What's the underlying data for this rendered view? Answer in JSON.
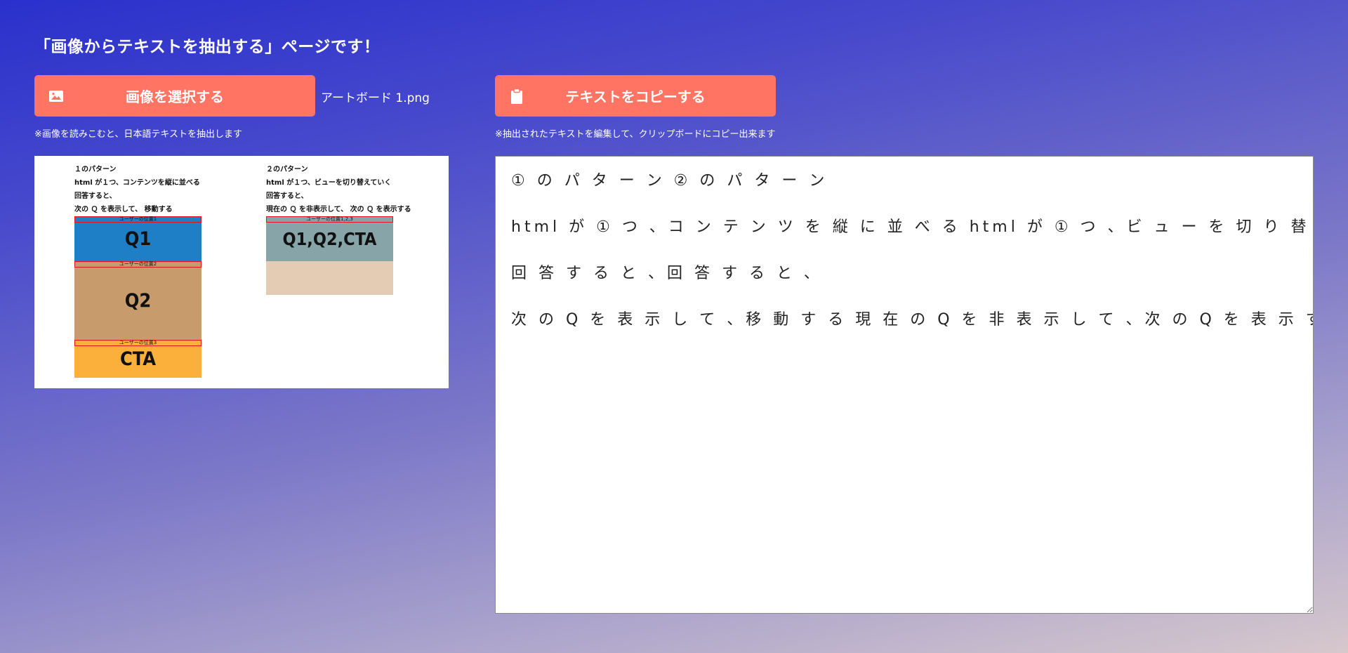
{
  "page_title": "「画像からテキストを抽出する」ページです！",
  "select_button": {
    "label": "画像を選択する",
    "icon": "image-icon"
  },
  "file_name": "アートボード 1.png",
  "copy_button": {
    "label": "テキストをコピーする",
    "icon": "clipboard-icon"
  },
  "note_left": "※画像を読みこむと、日本語テキストを抽出します",
  "note_right": "※抽出されたテキストを編集して、クリップボードにコピー出来ます",
  "preview": {
    "p1_title": "１のパターン",
    "p1_line1": "html が１つ、コンテンツを縦に並べる",
    "p1_line2": "回答すると、",
    "p1_line3": "次の Ｑ を表示して、 移動する",
    "p2_title": "２のパターン",
    "p2_line1": "html が１つ、ビューを切り替えていく",
    "p2_line2": "回答すると、",
    "p2_line3": "現在の Ｑ を非表示して、 次の Ｑ を表示する",
    "bar1": "ユーザーの位置1",
    "bar2": "ユーザーの位置2",
    "bar3": "ユーザーの位置3",
    "bar123": "ユーザーの位置1,2,3",
    "q1": "Q1",
    "q2": "Q2",
    "cta": "CTA",
    "q_all": "Q1,Q2,CTA",
    "colors": {
      "q1": "#1e7fc6",
      "q2": "#c89b6c",
      "cta": "#fbb03b",
      "q_all": "#87a4a8",
      "q_all_bottom": "#e3ccb3"
    }
  },
  "extracted_text": {
    "line1": "① の パ タ ー ン ② の パ タ ー ン",
    "line2": "html が ① つ 、コ ン テ ン ツ を 縦 に 並 べ る html が ① つ 、ビ ュ ー を 切 り 替 え て い く",
    "line3": "回 答 す る と 、回 答 す る と 、",
    "line4": "次 の Q を 表 示 し て 、移 動 す る 現 在 の Q を 非 表 示 し て 、次 の Q を 表 示 す る"
  },
  "colors": {
    "button": "#ff7462",
    "bg_top": "#2a30cc",
    "bg_bottom": "#d7c8cc"
  }
}
